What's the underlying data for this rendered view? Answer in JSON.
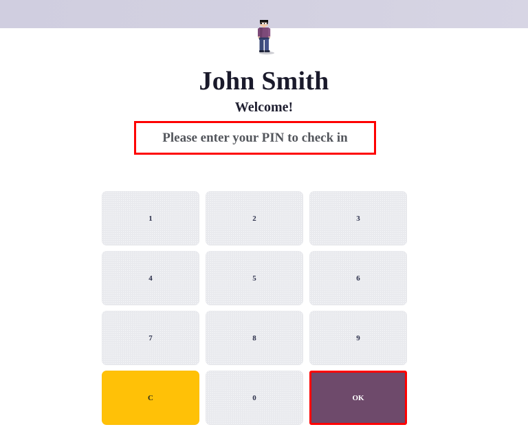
{
  "header": {
    "bar_color": "#d3d1e1"
  },
  "avatar": {
    "icon": "standing-person-avatar",
    "shirt_color": "#7d4a79",
    "pants_color": "#3b4a78",
    "hair_color": "#111111",
    "skin_color": "#f2c9a8"
  },
  "user": {
    "name": "John Smith",
    "greeting": "Welcome!"
  },
  "prompt": {
    "text": "Please enter your PIN to check in",
    "highlight_color": "#fe0000",
    "text_color": "#53565c"
  },
  "keypad": {
    "keys": [
      {
        "label": "1",
        "name": "keypad-key-1",
        "style": "digit"
      },
      {
        "label": "2",
        "name": "keypad-key-2",
        "style": "digit"
      },
      {
        "label": "3",
        "name": "keypad-key-3",
        "style": "digit"
      },
      {
        "label": "4",
        "name": "keypad-key-4",
        "style": "digit"
      },
      {
        "label": "5",
        "name": "keypad-key-5",
        "style": "digit"
      },
      {
        "label": "6",
        "name": "keypad-key-6",
        "style": "digit"
      },
      {
        "label": "7",
        "name": "keypad-key-7",
        "style": "digit"
      },
      {
        "label": "8",
        "name": "keypad-key-8",
        "style": "digit"
      },
      {
        "label": "9",
        "name": "keypad-key-9",
        "style": "digit"
      },
      {
        "label": "C",
        "name": "keypad-key-clear",
        "style": "clear"
      },
      {
        "label": "0",
        "name": "keypad-key-0",
        "style": "digit"
      },
      {
        "label": "OK",
        "name": "keypad-key-ok",
        "style": "ok"
      }
    ],
    "digit_color": "#2b2f4a",
    "digit_bg": "#e9eaee",
    "clear_bg": "#ffc107",
    "ok_bg": "#6e4a6b",
    "ok_text_color": "#ffffff",
    "ok_highlight_color": "#fe0000"
  }
}
